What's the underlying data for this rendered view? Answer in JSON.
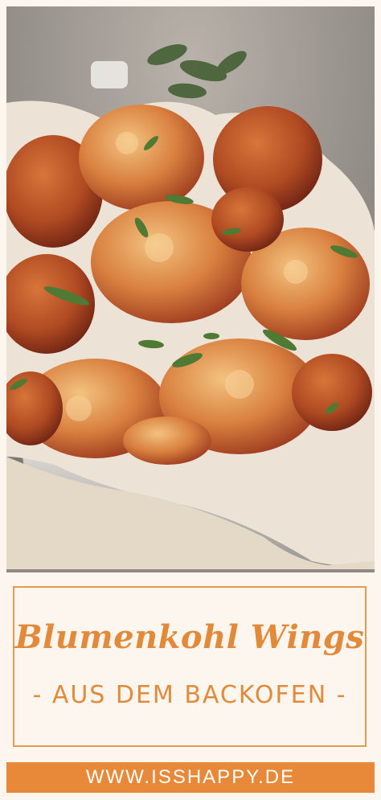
{
  "photo": {
    "subject": "cauliflower-wings-in-paper-lined-bowl"
  },
  "title": {
    "main": "Blumenkohl Wings",
    "subtitle": "- AUS DEM BACKOFEN -"
  },
  "footer": {
    "url": "WWW.ISSHAPPY.DE"
  },
  "colors": {
    "accent": "#e8893a",
    "accent_border": "#e79a4e",
    "background": "#fdf6ef",
    "text_on_accent": "#ffffff"
  }
}
